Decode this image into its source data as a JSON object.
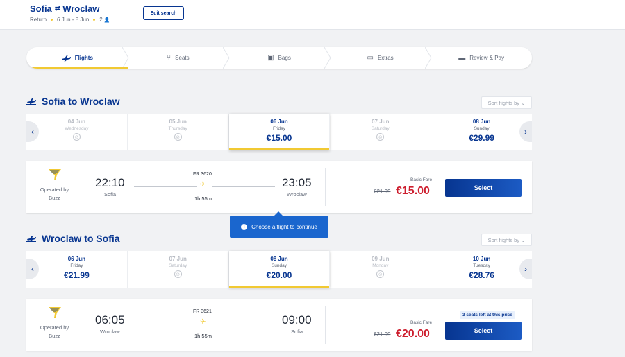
{
  "header": {
    "from": "Sofia",
    "to": "Wroclaw",
    "trip_type": "Return",
    "dates": "6 Jun - 8 Jun",
    "passengers": "2",
    "edit_label": "Edit search"
  },
  "steps": [
    {
      "label": "Flights",
      "icon": "plane-icon",
      "active": true
    },
    {
      "label": "Seats",
      "icon": "seat-icon",
      "active": false
    },
    {
      "label": "Bags",
      "icon": "bag-icon",
      "active": false
    },
    {
      "label": "Extras",
      "icon": "extras-icon",
      "active": false
    },
    {
      "label": "Review & Pay",
      "icon": "card-icon",
      "active": false
    }
  ],
  "outbound": {
    "title": "Sofia to Wroclaw",
    "sort_label": "Sort flights by",
    "dates": [
      {
        "date": "04 Jun",
        "weekday": "Wednesday",
        "price": null
      },
      {
        "date": "05 Jun",
        "weekday": "Thursday",
        "price": null
      },
      {
        "date": "06 Jun",
        "weekday": "Friday",
        "price": "€15.00",
        "selected": true
      },
      {
        "date": "07 Jun",
        "weekday": "Saturday",
        "price": null
      },
      {
        "date": "08 Jun",
        "weekday": "Sunday",
        "price": "€29.99"
      }
    ],
    "flight": {
      "operated": "Operated by",
      "carrier": "Buzz",
      "dep_time": "22:10",
      "dep_city": "Sofia",
      "flight_no": "FR 3620",
      "duration": "1h 55m",
      "arr_time": "23:05",
      "arr_city": "Wroclaw",
      "fare_label": "Basic Fare",
      "old_price": "€21.99",
      "price": "€15.00",
      "select_label": "Select"
    }
  },
  "tooltip": "Choose a flight to continue",
  "inbound": {
    "title": "Wroclaw to Sofia",
    "sort_label": "Sort flights by",
    "dates": [
      {
        "date": "06 Jun",
        "weekday": "Friday",
        "price": "€21.99"
      },
      {
        "date": "07 Jun",
        "weekday": "Saturday",
        "price": null
      },
      {
        "date": "08 Jun",
        "weekday": "Sunday",
        "price": "€20.00",
        "selected": true
      },
      {
        "date": "09 Jun",
        "weekday": "Monday",
        "price": null
      },
      {
        "date": "10 Jun",
        "weekday": "Tuesday",
        "price": "€28.76"
      }
    ],
    "flight": {
      "operated": "Operated by",
      "carrier": "Buzz",
      "dep_time": "06:05",
      "dep_city": "Wroclaw",
      "flight_no": "FR 3621",
      "duration": "1h 55m",
      "arr_time": "09:00",
      "arr_city": "Sofia",
      "fare_label": "Basic Fare",
      "old_price": "€21.99",
      "price": "€20.00",
      "select_label": "Select",
      "seats_left": "3 seats left at this price"
    }
  },
  "colors": {
    "brand_blue": "#073590",
    "yellow": "#f1c933",
    "price_red": "#cd1e2e",
    "tooltip_blue": "#1a66ce"
  }
}
